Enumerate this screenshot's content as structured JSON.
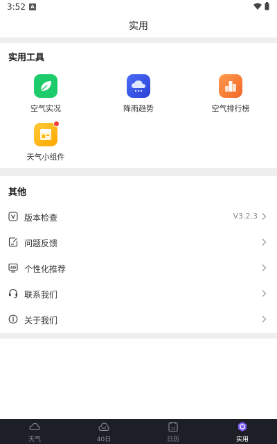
{
  "status_bar": {
    "time": "3:52",
    "notification_letter": "A"
  },
  "header": {
    "title": "实用"
  },
  "tools": {
    "title": "实用工具",
    "items": [
      {
        "label": "空气实况",
        "icon": "leaf-icon",
        "color": "#1ecb6b"
      },
      {
        "label": "降雨趋势",
        "icon": "rain-cloud-icon",
        "color": "#3a5cf2"
      },
      {
        "label": "空气排行榜",
        "icon": "ranking-podium-icon",
        "color": "#f37a30"
      },
      {
        "label": "天气小组件",
        "icon": "widget-icon",
        "color": "#ffb300",
        "has_badge": true
      }
    ]
  },
  "others": {
    "title": "其他",
    "items": [
      {
        "label": "版本检查",
        "icon": "version-icon",
        "value": "V3.2.3"
      },
      {
        "label": "问题反馈",
        "icon": "feedback-icon",
        "value": ""
      },
      {
        "label": "个性化推荐",
        "icon": "ad-icon",
        "value": ""
      },
      {
        "label": "联系我们",
        "icon": "headset-icon",
        "value": ""
      },
      {
        "label": "关于我们",
        "icon": "info-icon",
        "value": ""
      }
    ]
  },
  "tab_bar": {
    "tabs": [
      {
        "label": "天气",
        "icon": "cloud-icon",
        "active": false
      },
      {
        "label": "40日",
        "icon": "forty-day-icon",
        "icon_text": "40",
        "active": false
      },
      {
        "label": "日历",
        "icon": "calendar-icon",
        "icon_text": "12",
        "active": false
      },
      {
        "label": "实用",
        "icon": "tools-hexagon-icon",
        "active": true
      }
    ]
  }
}
